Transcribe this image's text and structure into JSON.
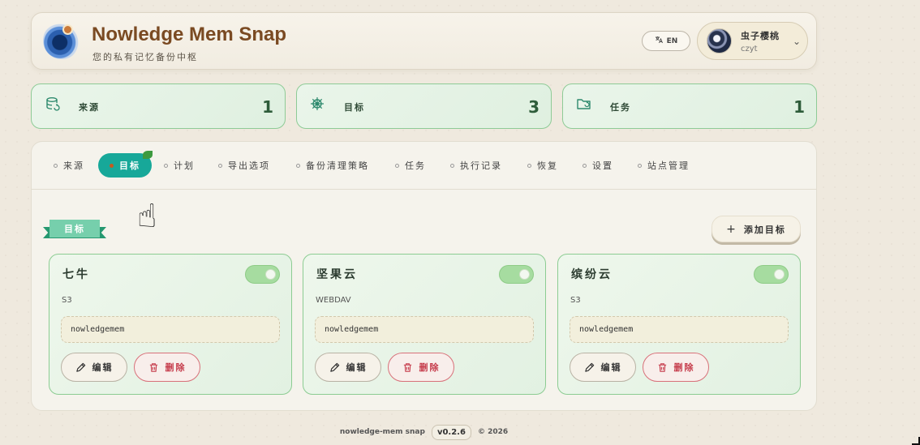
{
  "header": {
    "title": "Nowledge Mem Snap",
    "subtitle": "您的私有记忆备份中枢",
    "lang_label": "EN",
    "user": {
      "name": "虫子樱桃",
      "id": "czyt"
    }
  },
  "stats": [
    {
      "label": "来源",
      "value": "1",
      "icon": "database-icon"
    },
    {
      "label": "目标",
      "value": "3",
      "icon": "helm-icon"
    },
    {
      "label": "任务",
      "value": "1",
      "icon": "folder-sync-icon"
    }
  ],
  "tabs": [
    {
      "label": "来源",
      "active": false
    },
    {
      "label": "目标",
      "active": true
    },
    {
      "label": "计划",
      "active": false
    },
    {
      "label": "导出选项",
      "active": false
    },
    {
      "label": "备份清理策略",
      "active": false
    },
    {
      "label": "任务",
      "active": false
    },
    {
      "label": "执行记录",
      "active": false
    },
    {
      "label": "恢复",
      "active": false
    },
    {
      "label": "设置",
      "active": false
    },
    {
      "label": "站点管理",
      "active": false
    }
  ],
  "section": {
    "title": "目标",
    "add_label": "添加目标"
  },
  "cards": [
    {
      "name": "七牛",
      "type": "S3",
      "bucket": "nowledgemem",
      "enabled": true,
      "edit_label": "编辑",
      "delete_label": "删除"
    },
    {
      "name": "坚果云",
      "type": "WEBDAV",
      "bucket": "nowledgemem",
      "enabled": true,
      "edit_label": "编辑",
      "delete_label": "删除"
    },
    {
      "name": "缤纷云",
      "type": "S3",
      "bucket": "nowledgemem",
      "enabled": true,
      "edit_label": "编辑",
      "delete_label": "删除"
    }
  ],
  "footer": {
    "app": "nowledge-mem snap",
    "version": "v0.2.6",
    "copyright": "© 2026"
  },
  "colors": {
    "accent": "#17a899",
    "card_border": "#8ccc92",
    "danger": "#c53a4a",
    "title_brown": "#7a4a22"
  }
}
